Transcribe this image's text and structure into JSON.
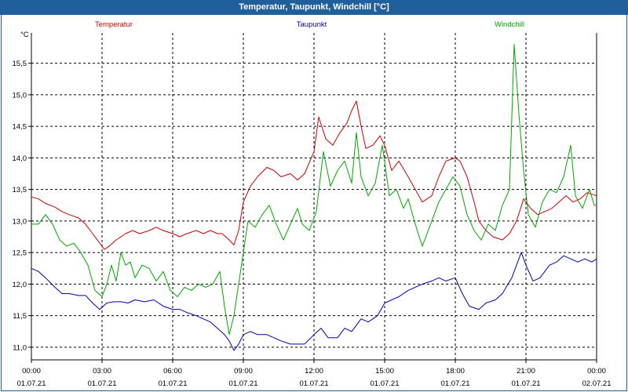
{
  "window": {
    "title": "Temperatur, Taupunkt, Windchill [°C]"
  },
  "colors": {
    "titlebar": "#1f5f9b",
    "temperatur": "#cc0000",
    "taupunkt": "#0000b0",
    "windchill": "#00a800"
  },
  "chart_data": {
    "type": "line",
    "title": "Temperatur, Taupunkt, Windchill [°C]",
    "ylabel": "°C",
    "xlabel": "",
    "ylim": [
      10.8,
      15.98
    ],
    "xlim": [
      0,
      24
    ],
    "grid": true,
    "legend_placement": "top",
    "yticks": [
      11.0,
      11.5,
      12.0,
      12.5,
      13.0,
      13.5,
      14.0,
      14.5,
      15.0,
      15.5
    ],
    "ytick_labels": [
      "11,0",
      "11,5",
      "12,0",
      "12,5",
      "13,0",
      "13,5",
      "14,0",
      "14,5",
      "15,0",
      "15,5"
    ],
    "xticks": [
      {
        "x": 0,
        "time": "00:00",
        "date": "01.07.21"
      },
      {
        "x": 3,
        "time": "03:00",
        "date": "01.07.21"
      },
      {
        "x": 6,
        "time": "06:00",
        "date": "01.07.21"
      },
      {
        "x": 9,
        "time": "09:00",
        "date": "01.07.21"
      },
      {
        "x": 12,
        "time": "12:00",
        "date": "01.07.21"
      },
      {
        "x": 15,
        "time": "15:00",
        "date": "01.07.21"
      },
      {
        "x": 18,
        "time": "18:00",
        "date": "01.07.21"
      },
      {
        "x": 21,
        "time": "21:00",
        "date": "01.07.21"
      },
      {
        "x": 24,
        "time": "00:00",
        "date": "02.07.21"
      }
    ],
    "series": [
      {
        "name": "Temperatur",
        "color": "#cc0000",
        "points": [
          [
            0,
            13.38
          ],
          [
            0.3,
            13.35
          ],
          [
            0.6,
            13.28
          ],
          [
            1.0,
            13.22
          ],
          [
            1.3,
            13.15
          ],
          [
            1.6,
            13.1
          ],
          [
            2.0,
            13.05
          ],
          [
            2.3,
            12.95
          ],
          [
            2.6,
            12.8
          ],
          [
            2.9,
            12.65
          ],
          [
            3.1,
            12.55
          ],
          [
            3.3,
            12.6
          ],
          [
            3.6,
            12.7
          ],
          [
            4.0,
            12.8
          ],
          [
            4.3,
            12.85
          ],
          [
            4.6,
            12.8
          ],
          [
            5.0,
            12.85
          ],
          [
            5.3,
            12.9
          ],
          [
            5.6,
            12.85
          ],
          [
            6.0,
            12.8
          ],
          [
            6.3,
            12.75
          ],
          [
            6.6,
            12.8
          ],
          [
            7.0,
            12.85
          ],
          [
            7.3,
            12.8
          ],
          [
            7.6,
            12.85
          ],
          [
            7.9,
            12.8
          ],
          [
            8.1,
            12.8
          ],
          [
            8.4,
            12.7
          ],
          [
            8.6,
            12.62
          ],
          [
            8.8,
            12.85
          ],
          [
            9.0,
            13.3
          ],
          [
            9.3,
            13.55
          ],
          [
            9.6,
            13.7
          ],
          [
            10.0,
            13.85
          ],
          [
            10.3,
            13.8
          ],
          [
            10.6,
            13.7
          ],
          [
            11.0,
            13.75
          ],
          [
            11.3,
            13.65
          ],
          [
            11.6,
            13.75
          ],
          [
            12.0,
            14.1
          ],
          [
            12.2,
            14.65
          ],
          [
            12.5,
            14.3
          ],
          [
            12.8,
            14.2
          ],
          [
            13.1,
            14.4
          ],
          [
            13.4,
            14.55
          ],
          [
            13.6,
            14.75
          ],
          [
            13.8,
            14.9
          ],
          [
            14.0,
            14.5
          ],
          [
            14.2,
            14.15
          ],
          [
            14.5,
            14.2
          ],
          [
            14.8,
            14.35
          ],
          [
            15.0,
            14.2
          ],
          [
            15.3,
            13.8
          ],
          [
            15.6,
            13.95
          ],
          [
            16.0,
            13.7
          ],
          [
            16.3,
            13.5
          ],
          [
            16.6,
            13.3
          ],
          [
            17.0,
            13.4
          ],
          [
            17.3,
            13.7
          ],
          [
            17.6,
            13.95
          ],
          [
            18.0,
            14.0
          ],
          [
            18.2,
            13.95
          ],
          [
            18.5,
            13.7
          ],
          [
            18.8,
            13.3
          ],
          [
            19.0,
            13.0
          ],
          [
            19.3,
            12.85
          ],
          [
            19.6,
            12.75
          ],
          [
            20.0,
            12.7
          ],
          [
            20.3,
            12.8
          ],
          [
            20.6,
            13.0
          ],
          [
            20.9,
            13.35
          ],
          [
            21.2,
            13.2
          ],
          [
            21.5,
            13.1
          ],
          [
            21.8,
            13.15
          ],
          [
            22.1,
            13.2
          ],
          [
            22.4,
            13.3
          ],
          [
            22.7,
            13.4
          ],
          [
            23.0,
            13.3
          ],
          [
            23.3,
            13.35
          ],
          [
            23.6,
            13.45
          ],
          [
            24.0,
            13.4
          ]
        ]
      },
      {
        "name": "Taupunkt",
        "color": "#0000b0",
        "points": [
          [
            0,
            12.25
          ],
          [
            0.3,
            12.2
          ],
          [
            0.6,
            12.1
          ],
          [
            1.0,
            11.95
          ],
          [
            1.3,
            11.85
          ],
          [
            1.6,
            11.85
          ],
          [
            2.0,
            11.82
          ],
          [
            2.3,
            11.82
          ],
          [
            2.6,
            11.7
          ],
          [
            2.9,
            11.6
          ],
          [
            3.2,
            11.7
          ],
          [
            3.5,
            11.72
          ],
          [
            3.8,
            11.72
          ],
          [
            4.1,
            11.7
          ],
          [
            4.4,
            11.75
          ],
          [
            4.8,
            11.72
          ],
          [
            5.2,
            11.75
          ],
          [
            5.6,
            11.65
          ],
          [
            6.0,
            11.6
          ],
          [
            6.3,
            11.6
          ],
          [
            6.6,
            11.55
          ],
          [
            7.0,
            11.5
          ],
          [
            7.3,
            11.45
          ],
          [
            7.6,
            11.4
          ],
          [
            7.9,
            11.3
          ],
          [
            8.2,
            11.2
          ],
          [
            8.4,
            11.1
          ],
          [
            8.6,
            10.95
          ],
          [
            8.8,
            11.05
          ],
          [
            9.0,
            11.2
          ],
          [
            9.3,
            11.25
          ],
          [
            9.6,
            11.2
          ],
          [
            10.0,
            11.2
          ],
          [
            10.3,
            11.15
          ],
          [
            10.6,
            11.1
          ],
          [
            11.0,
            11.05
          ],
          [
            11.3,
            11.05
          ],
          [
            11.6,
            11.05
          ],
          [
            12.0,
            11.2
          ],
          [
            12.3,
            11.3
          ],
          [
            12.6,
            11.15
          ],
          [
            13.0,
            11.15
          ],
          [
            13.3,
            11.3
          ],
          [
            13.6,
            11.25
          ],
          [
            14.0,
            11.45
          ],
          [
            14.3,
            11.4
          ],
          [
            14.7,
            11.5
          ],
          [
            15.0,
            11.7
          ],
          [
            15.3,
            11.75
          ],
          [
            15.6,
            11.8
          ],
          [
            16.0,
            11.9
          ],
          [
            16.3,
            11.95
          ],
          [
            16.6,
            12.0
          ],
          [
            17.0,
            12.05
          ],
          [
            17.3,
            12.1
          ],
          [
            17.6,
            12.05
          ],
          [
            18.0,
            12.1
          ],
          [
            18.3,
            11.85
          ],
          [
            18.6,
            11.65
          ],
          [
            19.0,
            11.6
          ],
          [
            19.3,
            11.7
          ],
          [
            19.7,
            11.75
          ],
          [
            20.0,
            11.85
          ],
          [
            20.4,
            12.1
          ],
          [
            20.8,
            12.5
          ],
          [
            21.0,
            12.3
          ],
          [
            21.3,
            12.05
          ],
          [
            21.6,
            12.1
          ],
          [
            22.0,
            12.3
          ],
          [
            22.3,
            12.35
          ],
          [
            22.6,
            12.45
          ],
          [
            22.9,
            12.4
          ],
          [
            23.2,
            12.35
          ],
          [
            23.5,
            12.4
          ],
          [
            23.8,
            12.35
          ],
          [
            24.0,
            12.4
          ]
        ]
      },
      {
        "name": "Windchill",
        "color": "#00a800",
        "points": [
          [
            0,
            12.95
          ],
          [
            0.3,
            12.95
          ],
          [
            0.6,
            13.1
          ],
          [
            0.9,
            12.95
          ],
          [
            1.2,
            12.7
          ],
          [
            1.5,
            12.6
          ],
          [
            1.8,
            12.65
          ],
          [
            2.1,
            12.5
          ],
          [
            2.4,
            12.3
          ],
          [
            2.7,
            11.9
          ],
          [
            3.0,
            11.8
          ],
          [
            3.2,
            12.0
          ],
          [
            3.4,
            12.3
          ],
          [
            3.6,
            12.05
          ],
          [
            3.8,
            12.5
          ],
          [
            4.0,
            12.3
          ],
          [
            4.2,
            12.35
          ],
          [
            4.4,
            12.1
          ],
          [
            4.7,
            12.3
          ],
          [
            5.0,
            12.25
          ],
          [
            5.3,
            12.05
          ],
          [
            5.6,
            12.2
          ],
          [
            5.9,
            11.9
          ],
          [
            6.2,
            11.8
          ],
          [
            6.5,
            11.95
          ],
          [
            6.8,
            11.9
          ],
          [
            7.1,
            12.0
          ],
          [
            7.4,
            11.95
          ],
          [
            7.7,
            12.0
          ],
          [
            8.0,
            12.2
          ],
          [
            8.2,
            11.65
          ],
          [
            8.4,
            11.2
          ],
          [
            8.6,
            11.5
          ],
          [
            8.8,
            12.0
          ],
          [
            9.0,
            12.5
          ],
          [
            9.2,
            13.0
          ],
          [
            9.5,
            12.9
          ],
          [
            9.8,
            13.1
          ],
          [
            10.1,
            13.25
          ],
          [
            10.4,
            12.95
          ],
          [
            10.7,
            12.7
          ],
          [
            11.0,
            12.95
          ],
          [
            11.3,
            13.2
          ],
          [
            11.5,
            12.95
          ],
          [
            11.8,
            12.85
          ],
          [
            12.1,
            13.15
          ],
          [
            12.4,
            14.1
          ],
          [
            12.7,
            13.55
          ],
          [
            13.0,
            13.8
          ],
          [
            13.3,
            13.95
          ],
          [
            13.6,
            13.6
          ],
          [
            13.8,
            14.4
          ],
          [
            14.0,
            13.7
          ],
          [
            14.3,
            13.4
          ],
          [
            14.6,
            13.6
          ],
          [
            14.9,
            14.2
          ],
          [
            15.2,
            13.4
          ],
          [
            15.5,
            13.5
          ],
          [
            15.8,
            13.2
          ],
          [
            16.0,
            13.35
          ],
          [
            16.3,
            12.95
          ],
          [
            16.6,
            12.6
          ],
          [
            17.0,
            13.0
          ],
          [
            17.3,
            13.3
          ],
          [
            17.6,
            13.5
          ],
          [
            17.9,
            13.7
          ],
          [
            18.2,
            13.55
          ],
          [
            18.5,
            13.1
          ],
          [
            18.8,
            12.85
          ],
          [
            19.1,
            12.7
          ],
          [
            19.4,
            12.95
          ],
          [
            19.7,
            12.85
          ],
          [
            20.0,
            13.25
          ],
          [
            20.3,
            13.5
          ],
          [
            20.5,
            15.8
          ],
          [
            20.7,
            14.7
          ],
          [
            20.9,
            13.8
          ],
          [
            21.1,
            13.1
          ],
          [
            21.4,
            12.9
          ],
          [
            21.7,
            13.3
          ],
          [
            22.0,
            13.5
          ],
          [
            22.3,
            13.45
          ],
          [
            22.6,
            13.7
          ],
          [
            22.9,
            14.2
          ],
          [
            23.1,
            13.4
          ],
          [
            23.4,
            13.2
          ],
          [
            23.7,
            13.5
          ],
          [
            23.9,
            13.25
          ],
          [
            24.0,
            13.25
          ]
        ]
      }
    ]
  }
}
